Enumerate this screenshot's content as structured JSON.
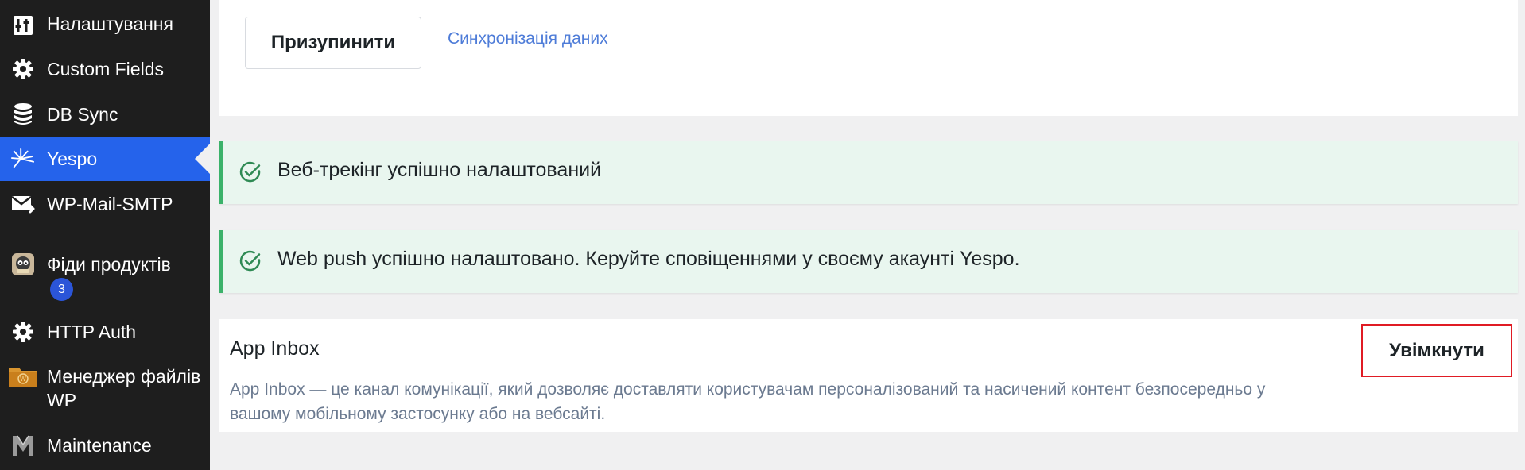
{
  "sidebar": {
    "items": [
      {
        "label": "Налаштування",
        "icon": "settings-sliders-icon"
      },
      {
        "label": "Custom Fields",
        "icon": "gear-icon"
      },
      {
        "label": "DB Sync",
        "icon": "database-icon"
      },
      {
        "label": "Yespo",
        "icon": "yespo-logo-icon",
        "active": true
      },
      {
        "label": "WP-Mail-SMTP",
        "icon": "mail-send-icon"
      },
      {
        "label": "Фіди продуктів",
        "icon": "feed-plugin-icon",
        "badge": "3"
      },
      {
        "label": "HTTP Auth",
        "icon": "gear-icon"
      },
      {
        "label": "Менеджер файлів WP",
        "label_line1": "Менеджер файлів",
        "label_line2": "WP",
        "icon": "file-manager-icon"
      },
      {
        "label": "Maintenance",
        "icon": "maintenance-logo-icon"
      }
    ],
    "active_color": "#2563eb",
    "background": "#1e1e1e"
  },
  "top": {
    "pause_button": "Призупинити",
    "sync_link": "Синхронізація даних"
  },
  "notices": [
    {
      "text": "Веб-трекінг успішно налаштований",
      "type": "success"
    },
    {
      "text": "Web push успішно налаштовано. Керуйте сповіщеннями у своєму акаунті Yespo.",
      "type": "success"
    }
  ],
  "app_inbox": {
    "title": "App Inbox",
    "description": "App Inbox — це канал комунікації, який дозволяє доставляти користувачам персоналізований та насичений контент безпосередньо у вашому мобільному застосунку або на вебсайті.",
    "enable_button": "Увімкнути",
    "highlight_color": "#e01b24"
  },
  "colors": {
    "success_border": "#3bb26a",
    "success_bg": "#e9f6ef",
    "link": "#4e7cd8"
  }
}
